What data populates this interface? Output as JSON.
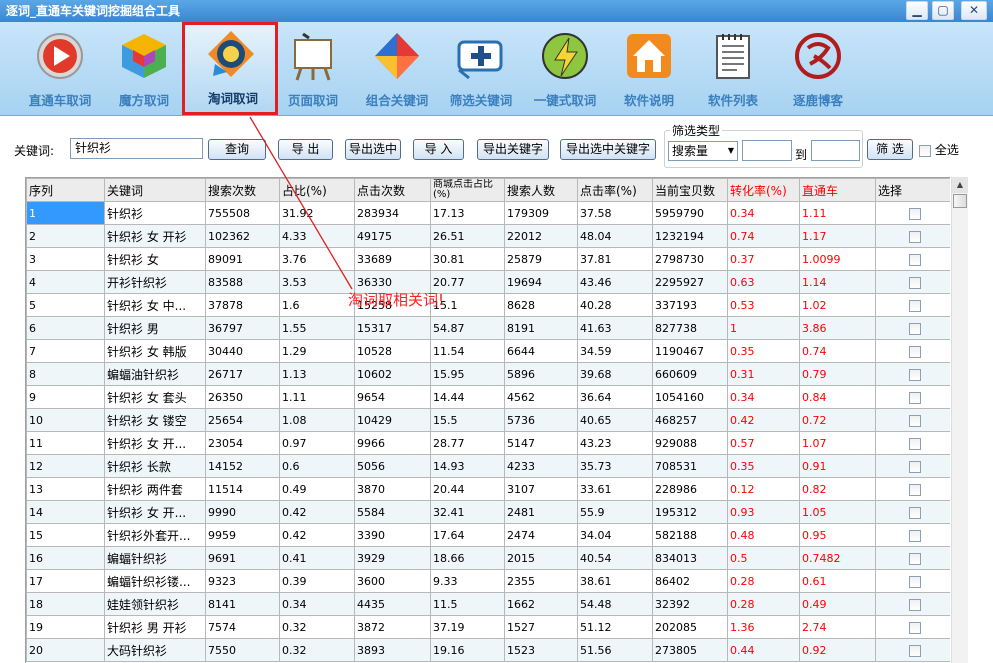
{
  "window": {
    "title": "逐词_直通车关键词挖掘组合工具"
  },
  "toolbar": [
    {
      "label": "直通车取词",
      "icon": "play-icon"
    },
    {
      "label": "魔方取词",
      "icon": "cube-icon"
    },
    {
      "label": "淘词取词",
      "icon": "taobao-icon"
    },
    {
      "label": "页面取词",
      "icon": "easel-icon"
    },
    {
      "label": "组合关键词",
      "icon": "diamond-icon"
    },
    {
      "label": "筛选关键词",
      "icon": "filter-icon"
    },
    {
      "label": "一键式取词",
      "icon": "bolt-icon"
    },
    {
      "label": "软件说明",
      "icon": "home-icon"
    },
    {
      "label": "软件列表",
      "icon": "notepad-icon"
    },
    {
      "label": "逐鹿博客",
      "icon": "blog-seal-icon"
    }
  ],
  "search": {
    "label": "关键词:",
    "value": "针织衫"
  },
  "buttons": {
    "query": "查询",
    "export": "导 出",
    "export_selected": "导出选中",
    "import": "导 入",
    "export_keywords": "导出关键字",
    "export_selected_keywords": "导出选中关键字",
    "filter": "筛 选"
  },
  "filter": {
    "title": "筛选类型",
    "select": "搜索量",
    "to": "到",
    "select_all": "全选"
  },
  "annotation": "淘词取相关词!",
  "columns": [
    "序列",
    "关键词",
    "搜索次数",
    "占比(%)",
    "点击次数",
    "商城点击占比(%)",
    "搜索人数",
    "点击率(%)",
    "当前宝贝数",
    "转化率(%)",
    "直通车",
    "选择"
  ],
  "rows": [
    [
      "1",
      "针织衫",
      "755508",
      "31.92",
      "283934",
      "17.13",
      "179309",
      "37.58",
      "5959790",
      "0.34",
      "1.11"
    ],
    [
      "2",
      "针织衫 女 开衫",
      "102362",
      "4.33",
      "49175",
      "26.51",
      "22012",
      "48.04",
      "1232194",
      "0.74",
      "1.17"
    ],
    [
      "3",
      "针织衫 女",
      "89091",
      "3.76",
      "33689",
      "30.81",
      "25879",
      "37.81",
      "2798730",
      "0.37",
      "1.0099"
    ],
    [
      "4",
      "开衫针织衫",
      "83588",
      "3.53",
      "36330",
      "20.77",
      "19694",
      "43.46",
      "2295927",
      "0.63",
      "1.14"
    ],
    [
      "5",
      "针织衫 女 中...",
      "37878",
      "1.6",
      "15258",
      "15.1",
      "8628",
      "40.28",
      "337193",
      "0.53",
      "1.02"
    ],
    [
      "6",
      "针织衫 男",
      "36797",
      "1.55",
      "15317",
      "54.87",
      "8191",
      "41.63",
      "827738",
      "1",
      "3.86"
    ],
    [
      "7",
      "针织衫 女 韩版",
      "30440",
      "1.29",
      "10528",
      "11.54",
      "6644",
      "34.59",
      "1190467",
      "0.35",
      "0.74"
    ],
    [
      "8",
      "蝙蝠油针织衫",
      "26717",
      "1.13",
      "10602",
      "15.95",
      "5896",
      "39.68",
      "660609",
      "0.31",
      "0.79"
    ],
    [
      "9",
      "针织衫 女 套头",
      "26350",
      "1.11",
      "9654",
      "14.44",
      "4562",
      "36.64",
      "1054160",
      "0.34",
      "0.84"
    ],
    [
      "10",
      "针织衫 女 镂空",
      "25654",
      "1.08",
      "10429",
      "15.5",
      "5736",
      "40.65",
      "468257",
      "0.42",
      "0.72"
    ],
    [
      "11",
      "针织衫 女 开...",
      "23054",
      "0.97",
      "9966",
      "28.77",
      "5147",
      "43.23",
      "929088",
      "0.57",
      "1.07"
    ],
    [
      "12",
      "针织衫 长款",
      "14152",
      "0.6",
      "5056",
      "14.93",
      "4233",
      "35.73",
      "708531",
      "0.35",
      "0.91"
    ],
    [
      "13",
      "针织衫 两件套",
      "11514",
      "0.49",
      "3870",
      "20.44",
      "3107",
      "33.61",
      "228986",
      "0.12",
      "0.82"
    ],
    [
      "14",
      "针织衫 女 开...",
      "9990",
      "0.42",
      "5584",
      "32.41",
      "2481",
      "55.9",
      "195312",
      "0.93",
      "1.05"
    ],
    [
      "15",
      "针织衫外套开...",
      "9959",
      "0.42",
      "3390",
      "17.64",
      "2474",
      "34.04",
      "582188",
      "0.48",
      "0.95"
    ],
    [
      "16",
      "蝙蝠针织衫",
      "9691",
      "0.41",
      "3929",
      "18.66",
      "2015",
      "40.54",
      "834013",
      "0.5",
      "0.7482"
    ],
    [
      "17",
      "蝙蝠针织衫镂...",
      "9323",
      "0.39",
      "3600",
      "9.33",
      "2355",
      "38.61",
      "86402",
      "0.28",
      "0.61"
    ],
    [
      "18",
      "娃娃领针织衫",
      "8141",
      "0.34",
      "4435",
      "11.5",
      "1662",
      "54.48",
      "32392",
      "0.28",
      "0.49"
    ],
    [
      "19",
      "针织衫 男 开衫",
      "7574",
      "0.32",
      "3872",
      "37.19",
      "1527",
      "51.12",
      "202085",
      "1.36",
      "2.74"
    ],
    [
      "20",
      "大码针织衫",
      "7550",
      "0.32",
      "3893",
      "19.16",
      "1523",
      "51.56",
      "273805",
      "0.44",
      "0.92"
    ]
  ]
}
